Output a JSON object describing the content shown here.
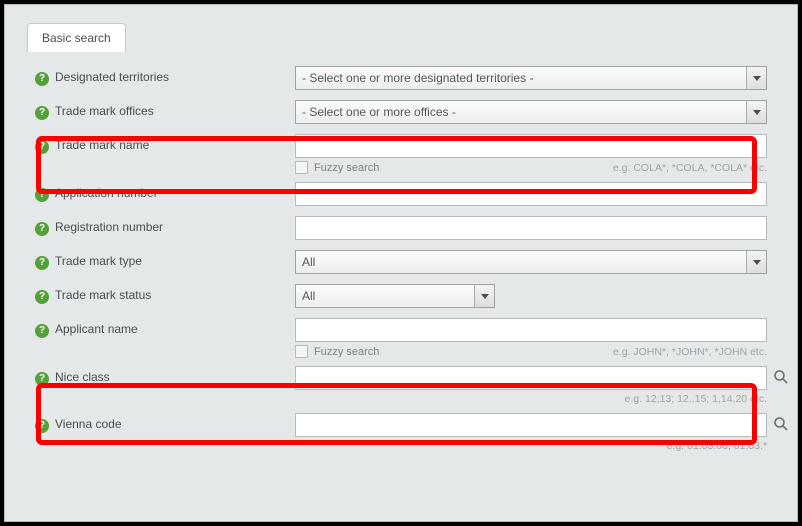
{
  "tab": {
    "label": "Basic search"
  },
  "fields": {
    "territories": {
      "label": "Designated territories",
      "value": "- Select one or more designated territories -"
    },
    "offices": {
      "label": "Trade mark offices",
      "value": "- Select one or more offices -"
    },
    "tmname": {
      "label": "Trade mark name",
      "fuzzy": "Fuzzy search",
      "eg": "e.g. COLA*, *COLA, *COLA* etc."
    },
    "appnum": {
      "label": "Application number"
    },
    "regnum": {
      "label": "Registration number"
    },
    "tmtype": {
      "label": "Trade mark type",
      "value": "All"
    },
    "tmstatus": {
      "label": "Trade mark status",
      "value": "All"
    },
    "applicant": {
      "label": "Applicant name",
      "fuzzy": "Fuzzy search",
      "eg": "e.g. JOHN*, *JOHN*, *JOHN etc."
    },
    "nice": {
      "label": "Nice class",
      "eg": "e.g. 12,13; 12..15; 1,14,20 etc."
    },
    "vienna": {
      "label": "Vienna code",
      "eg": "e.g. 01.03.06, 01.03.*"
    }
  },
  "helpGlyph": "?"
}
